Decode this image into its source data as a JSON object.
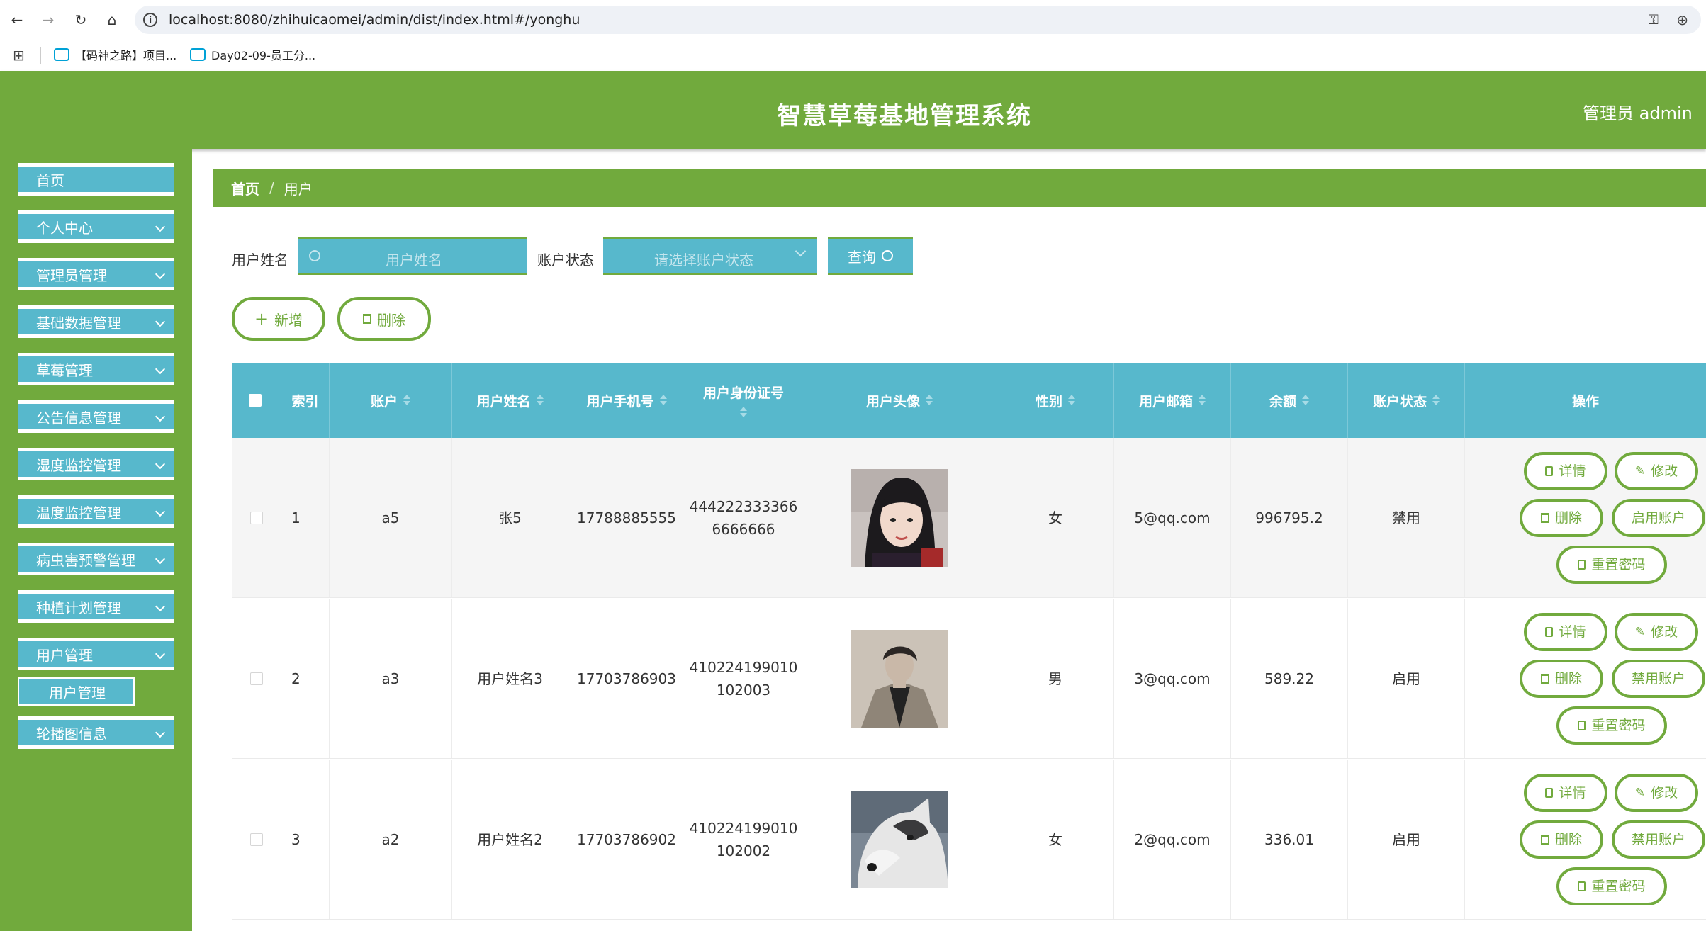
{
  "browser": {
    "url": "localhost:8080/zhihuicaomei/admin/dist/index.html#/yonghu",
    "bookmarks": [
      "【码神之路】项目...",
      "Day02-09-员工分..."
    ]
  },
  "header": {
    "title": "智慧草莓基地管理系统",
    "user_label": "管理员 admin"
  },
  "sidebar": {
    "items": [
      {
        "label": "首页",
        "has_chevron": false
      },
      {
        "label": "个人中心",
        "has_chevron": true
      },
      {
        "label": "管理员管理",
        "has_chevron": true
      },
      {
        "label": "基础数据管理",
        "has_chevron": true
      },
      {
        "label": "草莓管理",
        "has_chevron": true
      },
      {
        "label": "公告信息管理",
        "has_chevron": true
      },
      {
        "label": "湿度监控管理",
        "has_chevron": true
      },
      {
        "label": "温度监控管理",
        "has_chevron": true
      },
      {
        "label": "病虫害预警管理",
        "has_chevron": true
      },
      {
        "label": "种植计划管理",
        "has_chevron": true
      },
      {
        "label": "用户管理",
        "has_chevron": true
      },
      {
        "label": "轮播图信息",
        "has_chevron": true
      }
    ],
    "active_sub": "用户管理"
  },
  "breadcrumb": {
    "home": "首页",
    "separator": "/",
    "current": "用户"
  },
  "search": {
    "name_label": "用户姓名",
    "name_placeholder": "用户姓名",
    "status_label": "账户状态",
    "status_placeholder": "请选择账户状态",
    "query_label": "查询"
  },
  "toolbar": {
    "add_label": "新增",
    "delete_label": "删除"
  },
  "table": {
    "columns": [
      "索引",
      "账户",
      "用户姓名",
      "用户手机号",
      "用户身份证号",
      "用户头像",
      "性别",
      "用户邮箱",
      "余额",
      "账户状态",
      "操作"
    ],
    "rows": [
      {
        "index": "1",
        "account": "a5",
        "name": "张5",
        "phone": "17788885555",
        "id_line1": "444222333366",
        "id_line2": "6666666",
        "gender": "女",
        "email": "5@qq.com",
        "balance": "996795.2",
        "status": "禁用",
        "toggle_label": "启用账户"
      },
      {
        "index": "2",
        "account": "a3",
        "name": "用户姓名3",
        "phone": "17703786903",
        "id_line1": "410224199010",
        "id_line2": "102003",
        "gender": "男",
        "email": "3@qq.com",
        "balance": "589.22",
        "status": "启用",
        "toggle_label": "禁用账户"
      },
      {
        "index": "3",
        "account": "a2",
        "name": "用户姓名2",
        "phone": "17703786902",
        "id_line1": "410224199010",
        "id_line2": "102002",
        "gender": "女",
        "email": "2@qq.com",
        "balance": "336.01",
        "status": "启用",
        "toggle_label": "禁用账户"
      }
    ],
    "actions": {
      "detail": "详情",
      "edit": "修改",
      "delete": "删除",
      "reset": "重置密码"
    }
  },
  "colors": {
    "green": "#71aa3d",
    "teal": "#57b8cc",
    "row_alt": "#f5f5f5"
  }
}
